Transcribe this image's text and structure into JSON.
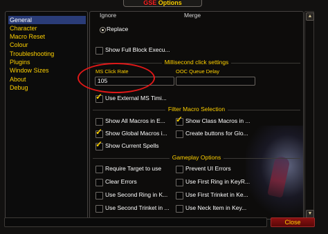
{
  "window": {
    "title_accent": "GSE",
    "title_rest": " Options"
  },
  "nav": {
    "items": [
      {
        "label": "General"
      },
      {
        "label": "Character"
      },
      {
        "label": "Macro Reset"
      },
      {
        "label": "Colour"
      },
      {
        "label": "Troubleshooting"
      },
      {
        "label": "Plugins"
      },
      {
        "label": "Window Sizes"
      },
      {
        "label": "About"
      },
      {
        "label": "Debug"
      }
    ]
  },
  "top_options": {
    "partial_left": "Ignore",
    "partial_right": "Merge",
    "replace_label": "Replace",
    "show_full_block": "Show Full Block Execu..."
  },
  "millisecond": {
    "title": "Millisecond click settings",
    "ms_click_rate_label": "MS Click Rate",
    "ms_click_rate_value": "105",
    "ooc_queue_delay_label": "OOC Queue Delay",
    "ooc_queue_delay_value": "",
    "use_external": "Use External MS Timi..."
  },
  "filter": {
    "title": "Filter Macro Selection",
    "show_all": "Show All Macros in E...",
    "show_class": "Show Class Macros in ...",
    "show_global": "Show Global Macros i...",
    "create_buttons": "Create buttons for Glo...",
    "show_current": "Show Current Spells"
  },
  "gameplay": {
    "title": "Gameplay Options",
    "require_target": "Require Target to use",
    "prevent_ui": "Prevent UI Errors",
    "clear_errors": "Clear Errors",
    "first_ring": "Use First Ring in KeyR...",
    "second_ring": "Use Second Ring in K...",
    "first_trinket": "Use First Trinket in Ke...",
    "second_trinket": "Use Second Trinket in ...",
    "neck_item": "Use Neck Item in Key..."
  },
  "footer": {
    "close_label": "Close"
  },
  "colors": {
    "gold": "#ffd100",
    "selection": "#2a3c78",
    "annotation_circle": "#e01818"
  }
}
